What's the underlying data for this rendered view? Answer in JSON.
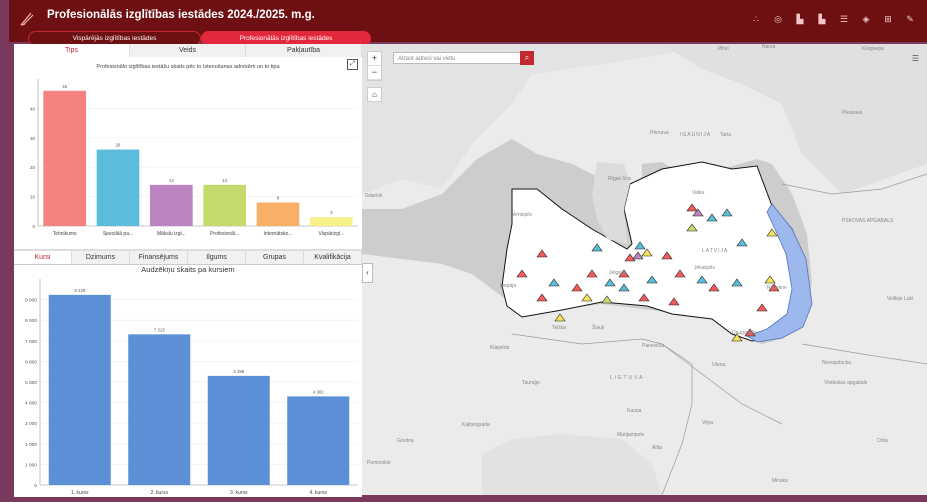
{
  "app": {
    "title": "Profesionālās izglītības iestādes 2024./2025. m.g."
  },
  "toggles": {
    "general": "Vispārējās izglītības iestādes",
    "vocational": "Profesionālās izglītības iestādes"
  },
  "top_tabs": [
    "Tips",
    "Veids",
    "Pakļautība"
  ],
  "bottom_tabs": [
    "Kursi",
    "Dzimums",
    "Finansējums",
    "Ilgums",
    "Grupas",
    "Kvalifikācija"
  ],
  "map": {
    "search_placeholder": "Atrast adresi vai vietu",
    "labels": [
      "IGAUNIJA",
      "Pērnava",
      "Tartu",
      "Rīgas līcis",
      "LATVIJA",
      "Ventspils",
      "Valka",
      "PSKOVAS APGABALS",
      "Liepāja",
      "Rēzekne",
      "Daugavpils",
      "Jelgava",
      "Jēkabpils",
      "Telšiai",
      "Šiauļi",
      "Panevēža",
      "Utena",
      "LIETUVA",
      "Kauņa",
      "Viļņa",
      "Klaipēda",
      "Tauraģe",
      "Kaļiņingrada",
      "Marijampole",
      "Alīta",
      "Novopolocka",
      "Minska",
      "Vitebskas apgabals",
      "Orša",
      "Velikije Luki",
      "Kingisepa",
      "Narva",
      "Jõhvi",
      "Pleskava",
      "Gdańsk",
      "Grodna",
      "Pomorskie"
    ]
  },
  "chart_data": [
    {
      "type": "bar",
      "title": "Profesionālo izglītības iestāžu skaits pēc to īstenošanas adresēm un to tipa",
      "categories": [
        "Tehnikums",
        "Speciālā pa...",
        "Mākslu izgl...",
        "Profesionāl...",
        "Internātsko...",
        "Vispārizgl..."
      ],
      "values": [
        46,
        26,
        14,
        14,
        8,
        3
      ],
      "colors": [
        "#f4837f",
        "#5bbcdb",
        "#bc84c2",
        "#c4da6c",
        "#f9b066",
        "#f7f18a"
      ],
      "ylim": [
        0,
        50
      ],
      "yticks": [
        0,
        10,
        20,
        30,
        40
      ]
    },
    {
      "type": "bar",
      "title": "Audzēkņu skaits pa kursiem",
      "categories": [
        "1. kurss",
        "2. kurss",
        "3. kurss",
        "4. kurss"
      ],
      "values": [
        9229,
        7313,
        5298,
        4302
      ],
      "value_labels": [
        "9 229",
        "7 313",
        "5 298",
        "4 302"
      ],
      "color": "#5b8fd6",
      "ylim": [
        0,
        10000
      ],
      "yticks": [
        0,
        1000,
        2000,
        3000,
        4000,
        5000,
        6000,
        7000,
        8000,
        9000
      ],
      "ytick_labels": [
        "0",
        "1 000",
        "2 000",
        "3 000",
        "4 000",
        "5 000",
        "6 000",
        "7 000",
        "8 000",
        "9 000"
      ]
    }
  ]
}
